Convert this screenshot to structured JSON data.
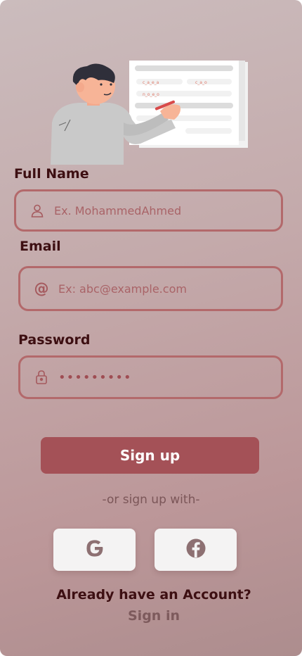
{
  "form": {
    "full_name": {
      "label": "Full Name",
      "placeholder": "Ex. MohammedAhmed"
    },
    "email": {
      "label": "Email",
      "placeholder": "Ex: abc@example.com"
    },
    "password": {
      "label": "Password",
      "masked_value": "•••••••••"
    }
  },
  "actions": {
    "signup_label": "Sign up",
    "or_text": "-or sign up with-",
    "social": [
      "google-icon",
      "facebook-icon"
    ]
  },
  "footer": {
    "already_text": "Already have an Account?",
    "signin_label": "Sign in"
  },
  "colors": {
    "accent": "#a45157",
    "label": "#3d0f12",
    "field_border": "#b3696b"
  }
}
